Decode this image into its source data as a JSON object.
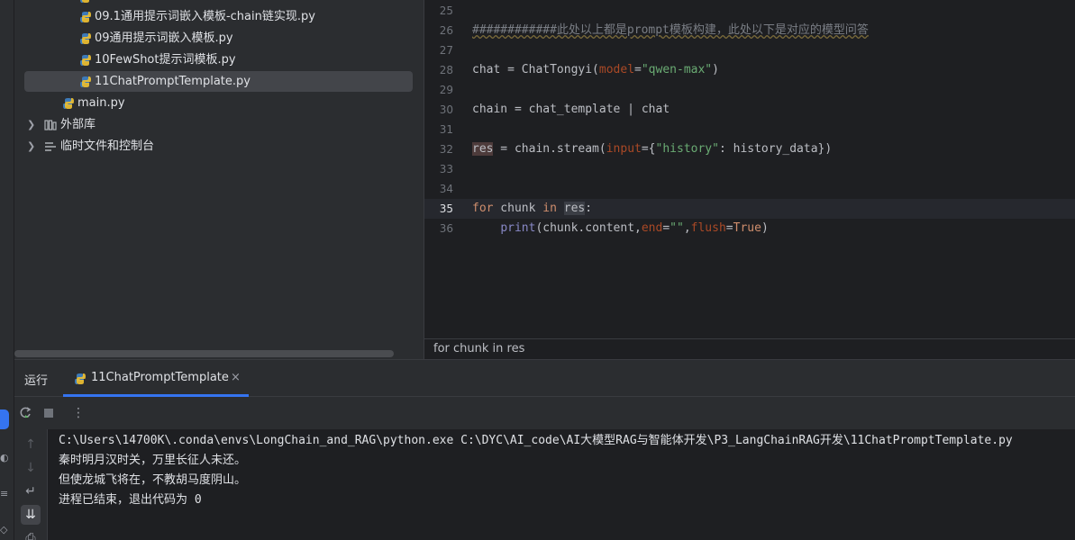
{
  "project_tree": {
    "items": [
      {
        "name": "09.1通用提示词嵌入模板-chain链实现.py",
        "kind": "python-file"
      },
      {
        "name": "09通用提示词嵌入模板.py",
        "kind": "python-file"
      },
      {
        "name": "10FewShot提示词模板.py",
        "kind": "python-file"
      },
      {
        "name": "11ChatPromptTemplate.py",
        "kind": "python-file",
        "selected": true
      },
      {
        "name": "main.py",
        "kind": "python-file"
      },
      {
        "name": "外部库",
        "kind": "external-libraries",
        "collapsed": true
      },
      {
        "name": "临时文件和控制台",
        "kind": "scratches",
        "collapsed": true
      }
    ]
  },
  "editor": {
    "line_numbers": [
      "25",
      "26",
      "27",
      "28",
      "29",
      "30",
      "31",
      "32",
      "33",
      "34",
      "35",
      "36"
    ],
    "active_line": "35",
    "lines": {
      "l26_comment": "############此处以上都是prompt模板构建，此处以下是对应的模型问答",
      "l28_a": "chat = ChatTongyi(",
      "l28_param": "model",
      "l28_eq": "=",
      "l28_str": "\"qwen-max\"",
      "l28_end": ")",
      "l30": "chain = chat_template | chat",
      "l32_res": "res",
      "l32_a": " = chain.stream(",
      "l32_param": "input",
      "l32_b": "={",
      "l32_str": "\"history\"",
      "l32_c": ": history_data})",
      "l35_for": "for",
      "l35_a": " chunk ",
      "l35_in": "in",
      "l35_sp": " ",
      "l35_res": "res",
      "l35_colon": ":",
      "l36_indent": "    ",
      "l36_print": "print",
      "l36_a": "(chunk.content,",
      "l36_param1": "end",
      "l36_eq1": "=",
      "l36_str": "\"\"",
      "l36_comma": ",",
      "l36_param2": "flush",
      "l36_eq2": "=",
      "l36_true": "True",
      "l36_end": ")"
    },
    "breadcrumb": "for chunk in res"
  },
  "run_panel": {
    "title": "运行",
    "tab_label": "11ChatPromptTemplate",
    "tab_close": "×",
    "console_lines": [
      "C:\\Users\\14700K\\.conda\\envs\\LongChain_and_RAG\\python.exe C:\\DYC\\AI_code\\AI大模型RAG与智能体开发\\P3_LangChainRAG开发\\11ChatPromptTemplate.py",
      "秦时明月汉时关，万里长征人未还。",
      "但使龙城飞将在，不教胡马度阴山。",
      "进程已结束，退出代码为 0"
    ]
  },
  "colors": {
    "accent": "#3574f0",
    "keyword": "#cf8e6d",
    "string": "#6aab73",
    "parameter": "#aa4926",
    "comment": "#7a7e85"
  }
}
